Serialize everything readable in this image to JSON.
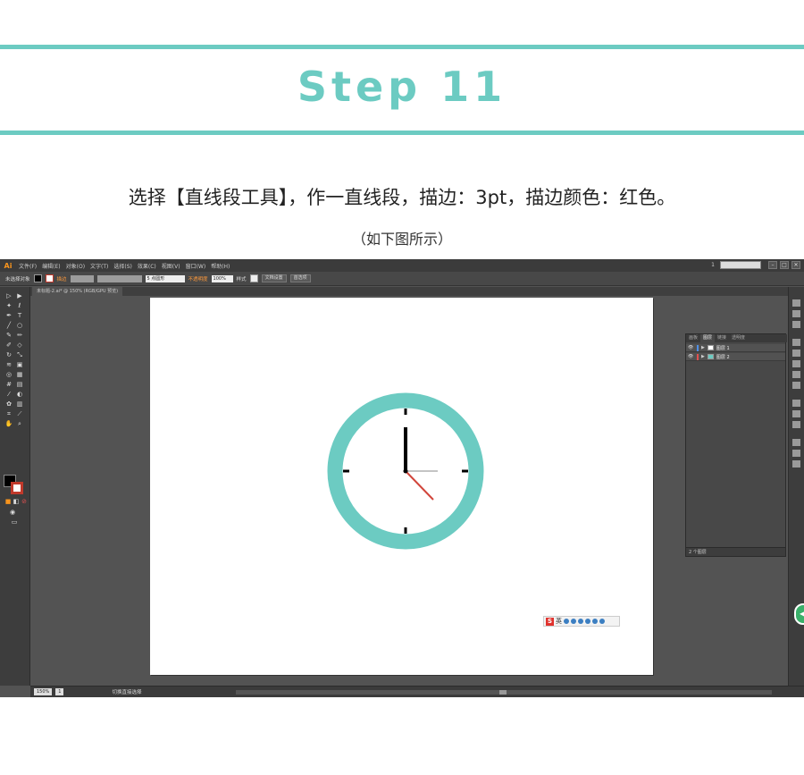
{
  "header": {
    "step_title": "Step 11",
    "instruction": "选择【直线段工具】，作一直线段，描边：3pt，描边颜色：红色。",
    "instruction_sub": "（如下图所示）",
    "accent_color": "#6ccbc2"
  },
  "illustrator": {
    "logo": "Ai",
    "menu": [
      "文件(F)",
      "编辑(E)",
      "对象(O)",
      "文字(T)",
      "选择(S)",
      "效果(C)",
      "视图(V)",
      "窗口(W)",
      "帮助(H)"
    ],
    "page_number": "1",
    "window_buttons": [
      "–",
      "□",
      "✕"
    ],
    "control_bar": {
      "selection_state": "未选择对象",
      "stroke_label": "描边",
      "stroke_weight": "5 点圆形",
      "opacity_label": "不透明度",
      "opacity_value": "100%",
      "style_label": "样式",
      "doc_setup_button": "文档设置",
      "preferences_button": "首选项"
    },
    "document_tab": "未标题-2.ai* @ 150% (RGB/GPU 预览)",
    "layers_panel": {
      "tabs": [
        "画板",
        "图层",
        "链接",
        "透明度"
      ],
      "active_tab": "图层",
      "layers": [
        {
          "name": "图层 1",
          "color": "#4f8fe6"
        },
        {
          "name": "图层 2",
          "color": "#e05050"
        }
      ],
      "layer_count": "2 个图层"
    },
    "status_bar": {
      "zoom": "150%",
      "artboard_number": "1",
      "current_tool": "切换直接选择"
    },
    "ime": {
      "logo": "S",
      "label": "英"
    },
    "clock": {
      "ring_color": "#6ccbc2",
      "hand_color": "#000000",
      "second_hand_color": "#d1453b"
    }
  }
}
